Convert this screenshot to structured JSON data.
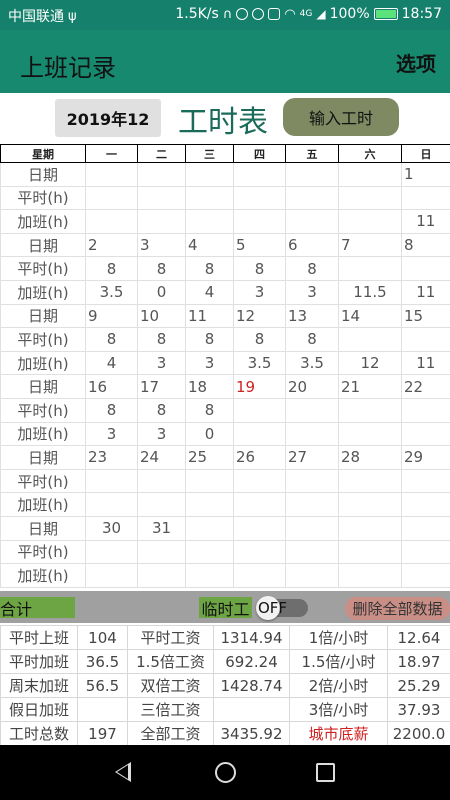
{
  "status_bar": {
    "carrier": "中国联通",
    "speed": "1.5K/s",
    "signal": "4G",
    "battery": "100%",
    "time": "18:57"
  },
  "app": {
    "title": "上班记录",
    "options": "选项"
  },
  "controls": {
    "month": "2019年12",
    "sheet_title": "工时表",
    "input_button": "输入工时"
  },
  "calendar": {
    "headers": [
      "星期",
      "一",
      "二",
      "三",
      "四",
      "五",
      "六",
      "日"
    ],
    "rows": [
      {
        "label": "日期",
        "type": "date",
        "cells": [
          "",
          "",
          "",
          "",
          "",
          "",
          "1"
        ]
      },
      {
        "label": "平时(h)",
        "type": "num",
        "cells": [
          "",
          "",
          "",
          "",
          "",
          "",
          ""
        ]
      },
      {
        "label": "加班(h)",
        "type": "num",
        "cells": [
          "",
          "",
          "",
          "",
          "",
          "",
          "11"
        ]
      },
      {
        "label": "日期",
        "type": "date",
        "cells": [
          "2",
          "3",
          "4",
          "5",
          "6",
          "7",
          "8"
        ]
      },
      {
        "label": "平时(h)",
        "type": "num",
        "cells": [
          "8",
          "8",
          "8",
          "8",
          "8",
          "",
          ""
        ]
      },
      {
        "label": "加班(h)",
        "type": "num",
        "cells": [
          "3.5",
          "0",
          "4",
          "3",
          "3",
          "11.5",
          "11"
        ]
      },
      {
        "label": "日期",
        "type": "date",
        "cells": [
          "9",
          "10",
          "11",
          "12",
          "13",
          "14",
          "15"
        ]
      },
      {
        "label": "平时(h)",
        "type": "num",
        "cells": [
          "8",
          "8",
          "8",
          "8",
          "8",
          "",
          ""
        ]
      },
      {
        "label": "加班(h)",
        "type": "num",
        "cells": [
          "4",
          "3",
          "3",
          "3.5",
          "3.5",
          "12",
          "11"
        ]
      },
      {
        "label": "日期",
        "type": "date",
        "cells": [
          "16",
          "17",
          "18",
          "19",
          "20",
          "21",
          "22"
        ]
      },
      {
        "label": "平时(h)",
        "type": "num",
        "cells": [
          "8",
          "8",
          "8",
          "",
          "",
          "",
          ""
        ]
      },
      {
        "label": "加班(h)",
        "type": "num",
        "cells": [
          "3",
          "3",
          "0",
          "",
          "",
          "",
          ""
        ]
      },
      {
        "label": "日期",
        "type": "date",
        "cells": [
          "23",
          "24",
          "25",
          "26",
          "27",
          "28",
          "29"
        ]
      },
      {
        "label": "平时(h)",
        "type": "num",
        "cells": [
          "",
          "",
          "",
          "",
          "",
          "",
          ""
        ]
      },
      {
        "label": "加班(h)",
        "type": "num",
        "cells": [
          "",
          "",
          "",
          "",
          "",
          "",
          ""
        ]
      },
      {
        "label": "日期",
        "type": "num",
        "cells": [
          "30",
          "31",
          "",
          "",
          "",
          "",
          ""
        ]
      },
      {
        "label": "平时(h)",
        "type": "num",
        "cells": [
          "",
          "",
          "",
          "",
          "",
          "",
          ""
        ]
      },
      {
        "label": "加班(h)",
        "type": "num",
        "cells": [
          "",
          "",
          "",
          "",
          "",
          "",
          ""
        ]
      }
    ],
    "today": "19",
    "today_color": "#d02020"
  },
  "bottom_bar": {
    "total_label": "合计",
    "temp_label": "临时工",
    "toggle_state": "OFF",
    "delete_button": "删除全部数据"
  },
  "summary": [
    [
      "平时上班",
      "104",
      "平时工资",
      "1314.94",
      "1倍/小时",
      "12.64"
    ],
    [
      "平时加班",
      "36.5",
      "1.5倍工资",
      "692.24",
      "1.5倍/小时",
      "18.97"
    ],
    [
      "周末加班",
      "56.5",
      "双倍工资",
      "1428.74",
      "2倍/小时",
      "25.29"
    ],
    [
      "假日加班",
      "",
      "三倍工资",
      "",
      "3倍/小时",
      "37.93"
    ],
    [
      "工时总数",
      "197",
      "全部工资",
      "3435.92",
      "城市底薪",
      "2200.0"
    ]
  ],
  "colors": {
    "primary": "#17896f",
    "status_bar": "#15806c",
    "accent_green": "#6ea544",
    "input_button": "#7f8962",
    "delete_button": "#c98f87",
    "highlight_red": "#d02020"
  }
}
